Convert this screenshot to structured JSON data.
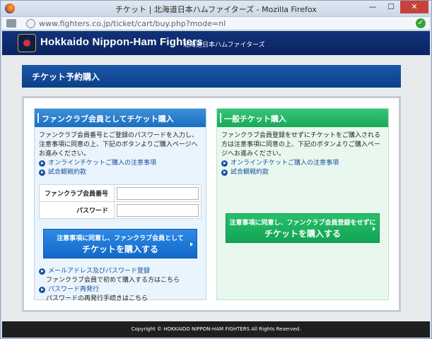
{
  "window": {
    "title": "チケット | 北海道日本ハムファイターズ - Mozilla Firefox",
    "url": "www.fighters.co.jp/ticket/cart/buy.php?mode=nl",
    "min_label": "—",
    "max_label": "☐",
    "close_label": "✕"
  },
  "header": {
    "brand": "Hokkaido Nippon-Ham Fighters",
    "brand_jp": "北海道日本ハムファイターズ"
  },
  "section": {
    "title": "チケット予約購入"
  },
  "member_panel": {
    "heading": "ファンクラブ会員としてチケット購入",
    "description": "ファンクラブ会員番号とご登録のパスワードを入力し、注意事項に同意の上、下記のボタンよりご購入ページへお進みください。",
    "links": [
      "オンラインチケットご購入の注意事項",
      "試合観戦約款"
    ],
    "form": {
      "member_no_label": "ファンクラブ会員番号",
      "password_label": "パスワード",
      "member_no_value": "",
      "password_value": ""
    },
    "button": {
      "line1": "注意事項に同意し、ファンクラブ会員として",
      "line2": "チケットを購入する"
    },
    "bottom_links": [
      {
        "label": "メールアドレス及びパスワード登録",
        "note": "ファンクラブ会員で初めて購入する方はこちら"
      },
      {
        "label": "パスワード再発行",
        "note": "パスワードの再発行手続きはこちら"
      }
    ]
  },
  "general_panel": {
    "heading": "一般チケット購入",
    "description": "ファンクラブ会員登録をせずにチケットをご購入される方は注意事項に同意の上、下記のボタンよりご購入ページへお進みください。",
    "links": [
      "オンラインチケットご購入の注意事項",
      "試合観戦約款"
    ],
    "button": {
      "line1": "注意事項に同意し、ファンクラブ会員登録をせずに",
      "line2": "チケットを購入する"
    }
  },
  "footer": {
    "copyright": "Copyright © HOKKAIDO NIPPON-HAM FIGHTERS All Rights Reserved."
  },
  "colors": {
    "header_navy": "#0a2460",
    "member_blue": "#1a6fc1",
    "general_green": "#17a85a",
    "link_blue": "#1a4fa0"
  }
}
